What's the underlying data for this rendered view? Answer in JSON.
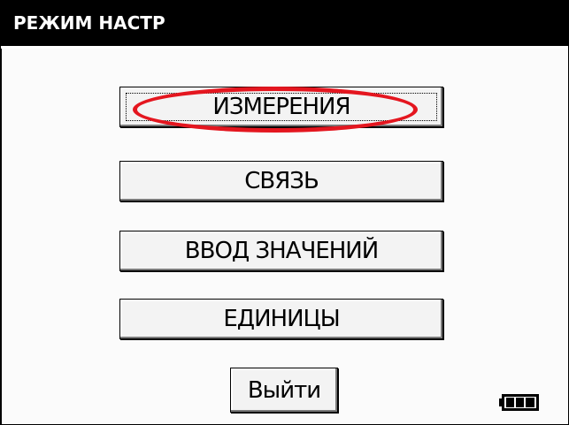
{
  "window": {
    "title": "РЕЖИМ НАСТР"
  },
  "menu": {
    "items": [
      {
        "label": "ИЗМЕРЕНИЯ"
      },
      {
        "label": "СВЯЗЬ"
      },
      {
        "label": "ВВОД ЗНАЧЕНИЙ"
      },
      {
        "label": "ЕДИНИЦЫ"
      }
    ],
    "exit_label": "Выйти"
  },
  "status": {
    "battery_icon": "battery-full-icon"
  },
  "colors": {
    "highlight": "#e4161f",
    "titlebar_bg": "#000000",
    "titlebar_fg": "#ffffff"
  }
}
